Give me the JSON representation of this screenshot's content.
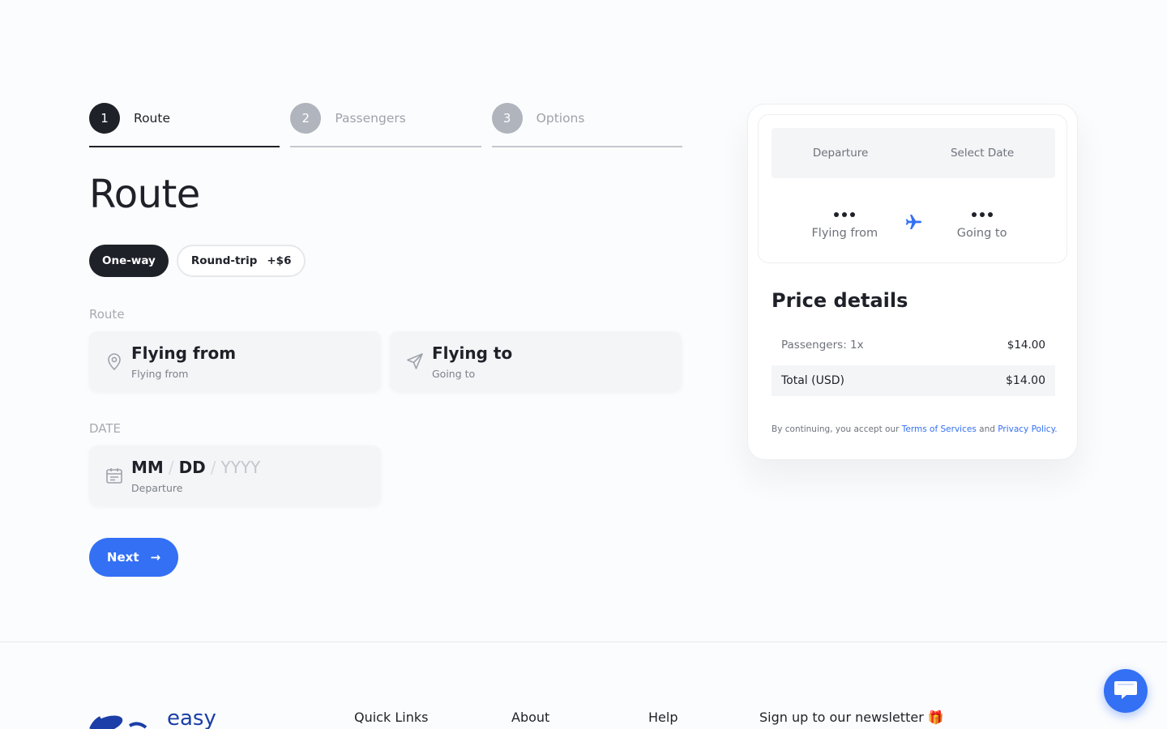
{
  "stepper": [
    {
      "number": "1",
      "label": "Route",
      "active": true
    },
    {
      "number": "2",
      "label": "Passengers",
      "active": false
    },
    {
      "number": "3",
      "label": "Options",
      "active": false
    }
  ],
  "page_title": "Route",
  "trip_types": {
    "one_way": "One-way",
    "round_trip": "Round-trip",
    "round_trip_extra": "+$6"
  },
  "route_section": {
    "label": "Route",
    "from": {
      "main": "Flying from",
      "sub": "Flying from",
      "icon": "map-pin-icon"
    },
    "to": {
      "main": "Flying to",
      "sub": "Going to",
      "icon": "send-icon"
    }
  },
  "date_section": {
    "label": "DATE",
    "mm": "MM",
    "dd": "DD",
    "yyyy": "YYYY",
    "sep": "/",
    "sub": "Departure",
    "icon": "calendar-icon"
  },
  "next_button": {
    "label": "Next",
    "arrow": "→"
  },
  "summary": {
    "departure_label": "Departure",
    "select_date": "Select Date",
    "flying_from": "Flying from",
    "going_to": "Going to",
    "price_title": "Price details",
    "passengers_label": "Passengers: 1x",
    "passengers_amount": "$14.00",
    "total_label": "Total (USD)",
    "total_amount": "$14.00",
    "terms_prefix": "By continuing, you accept our ",
    "terms_link": "Terms of Services",
    "terms_and": " and ",
    "privacy_link": "Privacy Policy."
  },
  "footer": {
    "logo_text": "easy",
    "quick_links": "Quick Links",
    "about": "About",
    "help": "Help",
    "newsletter": "Sign up to our newsletter 🎁"
  },
  "colors": {
    "accent": "#3370f4",
    "dark": "#1f2129",
    "muted": "#9ea2aa",
    "field_bg": "#f3f5f7"
  }
}
